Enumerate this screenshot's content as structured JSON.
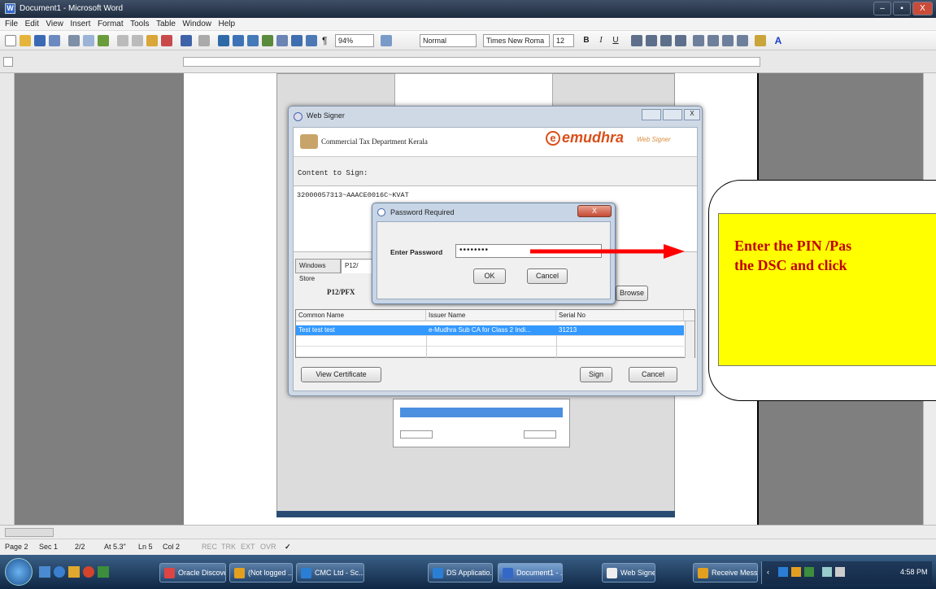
{
  "window": {
    "title": "Document1 - Microsoft Word",
    "controls": [
      "–",
      "▪",
      "X"
    ]
  },
  "menu": [
    "File",
    "Edit",
    "View",
    "Insert",
    "Format",
    "Tools",
    "Table",
    "Window",
    "Help"
  ],
  "toolbar": {
    "zoom": "94%",
    "style": "Normal",
    "font": "Times New Roma",
    "size": "12",
    "bold": "B",
    "italic": "I",
    "underline": "U"
  },
  "signer": {
    "title": "Web Signer",
    "department": "Commercial Tax Department Kerala",
    "brand": "emudhra",
    "brand_sub": "Web Signer",
    "content_label": "Content to Sign:",
    "content_value": "32000057313~AAACE0016C~KVAT",
    "tabs": [
      "Windows Store",
      "P12/"
    ],
    "pfx_label": "P12/PFX",
    "browse_label": "Browse",
    "columns": [
      "Common Name",
      "Issuer Name",
      "Serial No"
    ],
    "rows": [
      {
        "common": "Test test test",
        "issuer": "e-Mudhra Sub CA for Class 2 Indi...",
        "serial": "31213"
      }
    ],
    "view_cert": "View Certificate",
    "sign": "Sign",
    "cancel": "Cancel"
  },
  "password": {
    "title": "Password Required",
    "label": "Enter Password",
    "value": "••••••••",
    "ok": "OK",
    "cancel": "Cancel"
  },
  "callout": {
    "line1": "Enter the PIN /Pas",
    "line2": "the DSC and click"
  },
  "status": {
    "page": "Page 2",
    "sec": "Sec 1",
    "pages": "2/2",
    "at": "At 5.3\"",
    "ln": "Ln 5",
    "col": "Col 2",
    "rec": "REC",
    "trk": "TRK",
    "ext": "EXT",
    "ovr": "OVR"
  },
  "taskbar": {
    "items": [
      "Oracle Discover...",
      "(Not logged ...",
      "CMC Ltd - Sc...",
      "DS Applicatio...",
      "Document1 - ...",
      "Web Signer",
      "Receive Mess..."
    ],
    "time": "4:58 PM"
  },
  "colors": {
    "callout_fill": "#ffff00",
    "callout_text": "#c00000",
    "arrow": "#ff0000",
    "selected_row": "#3399ff"
  }
}
